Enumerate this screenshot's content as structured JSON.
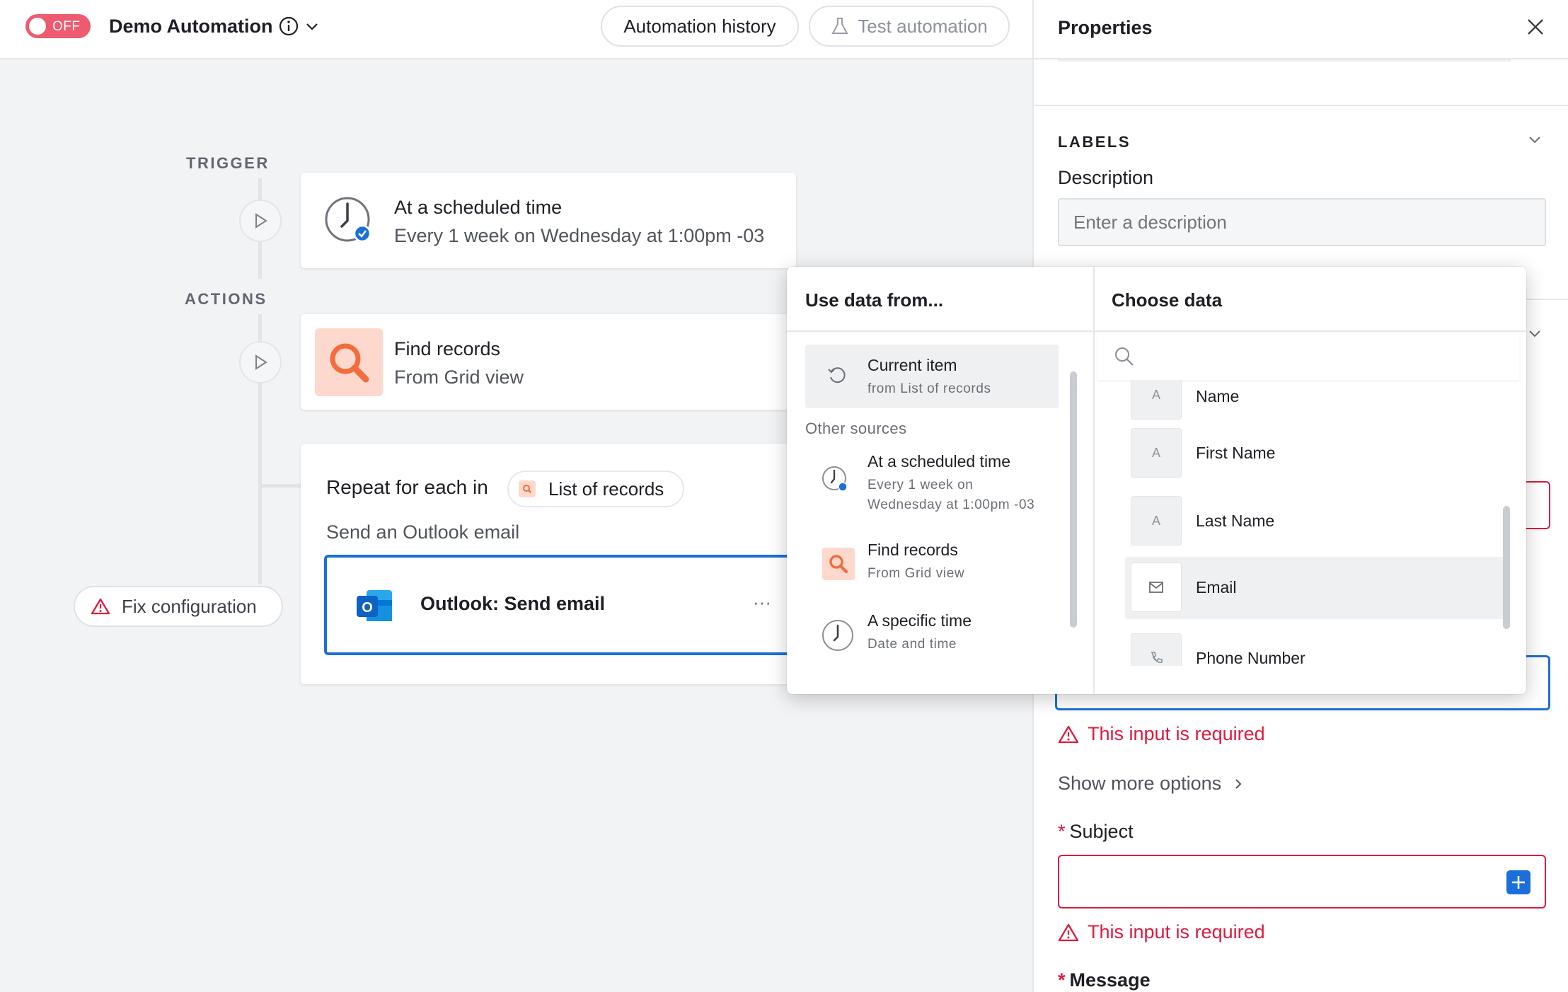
{
  "header": {
    "toggle_label": "OFF",
    "title": "Demo Automation",
    "history_button": "Automation history",
    "test_button": "Test automation"
  },
  "canvas": {
    "trigger_label": "TRIGGER",
    "actions_label": "ACTIONS",
    "trigger_card": {
      "title": "At a scheduled time",
      "subtitle": "Every 1 week on Wednesday at 1:00pm -03"
    },
    "find_card": {
      "title": "Find records",
      "subtitle": "From Grid view"
    },
    "repeat_card": {
      "prefix": "Repeat for each in",
      "source": "List of records",
      "description": "Send an Outlook email"
    },
    "email_card": {
      "title": "Outlook: Send email",
      "more": "···"
    },
    "fix_button": "Fix configuration"
  },
  "panel": {
    "title": "Properties",
    "labels_section": "LABELS",
    "description_label": "Description",
    "description_placeholder": "Enter a description",
    "error_required": "This input is required",
    "show_more": "Show more options",
    "subject_label": "Subject",
    "message_label": "Message",
    "required_mark": "*"
  },
  "popup": {
    "left_title": "Use data from...",
    "right_title": "Choose data",
    "current": {
      "title": "Current item",
      "subtitle": "from List of records"
    },
    "other_sources_label": "Other sources",
    "sources": [
      {
        "title": "At a scheduled time",
        "subtitle_1": "Every 1 week on",
        "subtitle_2": "Wednesday at 1:00pm -03"
      },
      {
        "title": "Find records",
        "subtitle": "From Grid view"
      },
      {
        "title": "A specific time",
        "subtitle": "Date and time"
      }
    ],
    "fields": [
      {
        "name": "Name",
        "icon": "text-icon"
      },
      {
        "name": "First Name",
        "icon": "text-icon"
      },
      {
        "name": "Last Name",
        "icon": "text-icon"
      },
      {
        "name": "Email",
        "icon": "email-icon"
      },
      {
        "name": "Phone Number",
        "icon": "phone-icon"
      }
    ]
  },
  "colors": {
    "toggle_off": "#ee5a6f",
    "error": "#dc1b3e",
    "accent_blue": "#1c6fd8",
    "find_orange": "#f26c3c"
  }
}
